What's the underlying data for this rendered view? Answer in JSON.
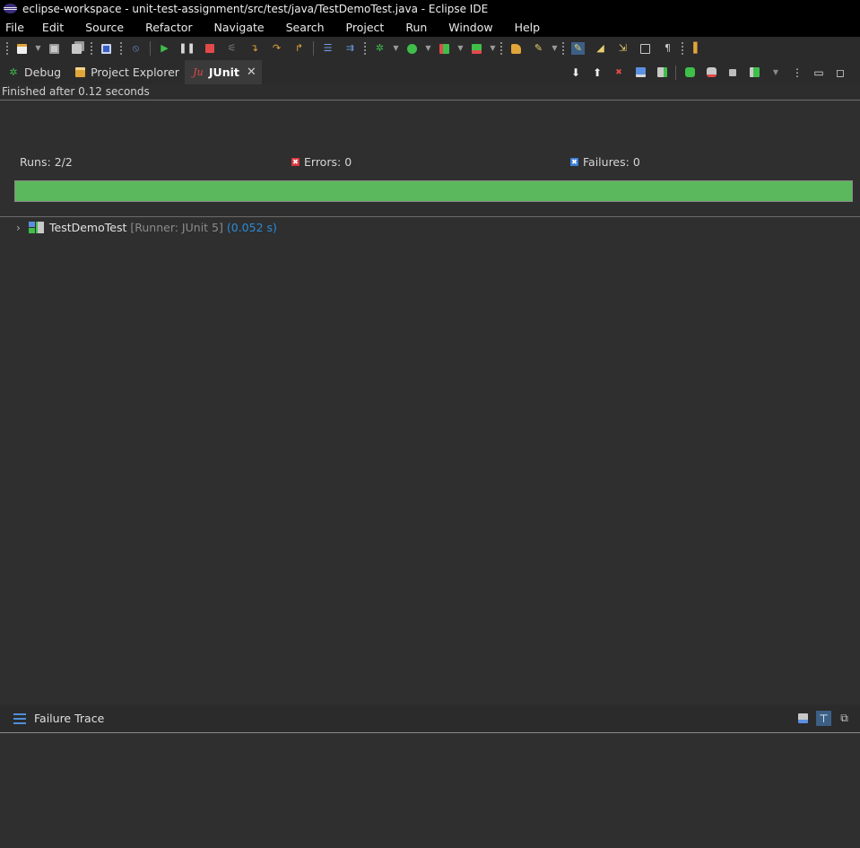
{
  "window": {
    "title": "eclipse-workspace - unit-test-assignment/src/test/java/TestDemoTest.java - Eclipse IDE"
  },
  "menu": [
    "File",
    "Edit",
    "Source",
    "Refactor",
    "Navigate",
    "Search",
    "Project",
    "Run",
    "Window",
    "Help"
  ],
  "toolbar": {
    "icons": [
      "new-icon",
      "save-icon",
      "save-all-icon",
      "terminal-icon",
      "skip-breakpoints-icon",
      "resume-icon",
      "suspend-icon",
      "terminate-icon",
      "disconnect-icon",
      "step-into-icon",
      "step-over-icon",
      "step-return-icon",
      "drop-to-frame-icon",
      "use-step-filters-icon",
      "debug-icon",
      "run-icon",
      "coverage-icon",
      "external-tools-icon",
      "open-type-icon",
      "search-icon",
      "mark-occurrences-icon",
      "highlight-icon",
      "next-annotation-icon",
      "block-selection-icon",
      "show-whitespace-icon"
    ]
  },
  "views": {
    "tabs": [
      {
        "label": "Debug",
        "icon": "debug-bug-icon"
      },
      {
        "label": "Project Explorer",
        "icon": "project-explorer-icon"
      },
      {
        "label": "JUnit",
        "icon": "junit-icon",
        "active": true
      }
    ],
    "tools": [
      "next-failure-icon",
      "previous-failure-icon",
      "show-failures-only-icon",
      "scroll-lock-icon",
      "show-skipped-only-icon",
      "rerun-test-icon",
      "rerun-failures-first-icon",
      "stop-icon",
      "test-run-history-icon",
      "view-menu-icon",
      "minimize-icon",
      "maximize-icon"
    ]
  },
  "junit": {
    "status": "Finished after 0.12 seconds",
    "runs_label": "Runs:",
    "runs_value": "2/2",
    "errors_label": "Errors:",
    "errors_value": "0",
    "failures_label": "Failures:",
    "failures_value": "0",
    "progress": 1.0,
    "colors": {
      "progress": "#5cb85c",
      "error": "#d9363e",
      "failure": "#3b7dd8",
      "time": "#2a8bd6"
    }
  },
  "tree": {
    "items": [
      {
        "name": "TestDemoTest",
        "runner": "[Runner: JUnit 5]",
        "time": "(0.052 s)",
        "icon": "test-suite-passed-icon"
      }
    ]
  },
  "failure_trace": {
    "title": "Failure Trace",
    "tools": [
      "compare-results-icon",
      "filter-stack-trace-icon",
      "copy-trace-icon"
    ]
  }
}
